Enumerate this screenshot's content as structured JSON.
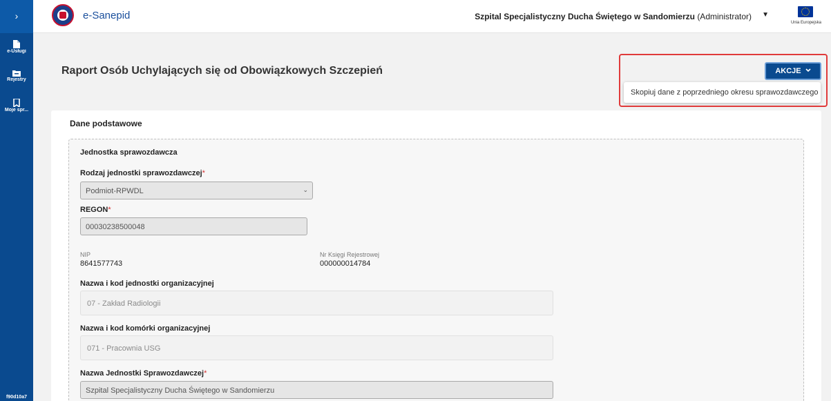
{
  "sidebar": {
    "toggle_label": "›",
    "items": [
      {
        "label": "e-Usługi",
        "icon": "document-icon"
      },
      {
        "label": "Rejestry",
        "icon": "folder-icon"
      },
      {
        "label": "Moje spr...",
        "icon": "bookmark-icon"
      }
    ],
    "version": "f90d10a7"
  },
  "header": {
    "app_name": "e-Sanepid",
    "org_name": "Szpital Specjalistyczny Ducha Świętego w Sandomierzu",
    "org_role": "(Administrator)",
    "eu_label": "Unia Europejska"
  },
  "page": {
    "title": "Raport Osób Uchylających się od Obowiązkowych Szczepień"
  },
  "actions": {
    "button_label": "AKCJE",
    "menu_items": [
      "Skopiuj dane z poprzedniego okresu sprawozdawczego"
    ]
  },
  "form": {
    "section_title": "Dane podstawowe",
    "group_title": "Jednostka sprawozdawcza",
    "unit_type_label": "Rodzaj jednostki sprawozdawczej",
    "unit_type_value": "Podmiot-RPWDL",
    "regon_label": "REGON",
    "regon_value": "00030238500048",
    "nip_label": "NIP",
    "nip_value": "8641577743",
    "krs_label": "Nr Księgi Rejestrowej",
    "krs_value": "000000014784",
    "org_unit_label": "Nazwa i kod jednostki organizacyjnej",
    "org_unit_value": "07 - Zakład Radiologii",
    "org_cell_label": "Nazwa i kod komórki organizacyjnej",
    "org_cell_value": "071 - Pracownia USG",
    "reporting_name_label": "Nazwa Jednostki Sprawozdawczej",
    "reporting_name_value": "Szpital Specjalistyczny Ducha Świętego w Sandomierzu",
    "required_mark": "*"
  }
}
